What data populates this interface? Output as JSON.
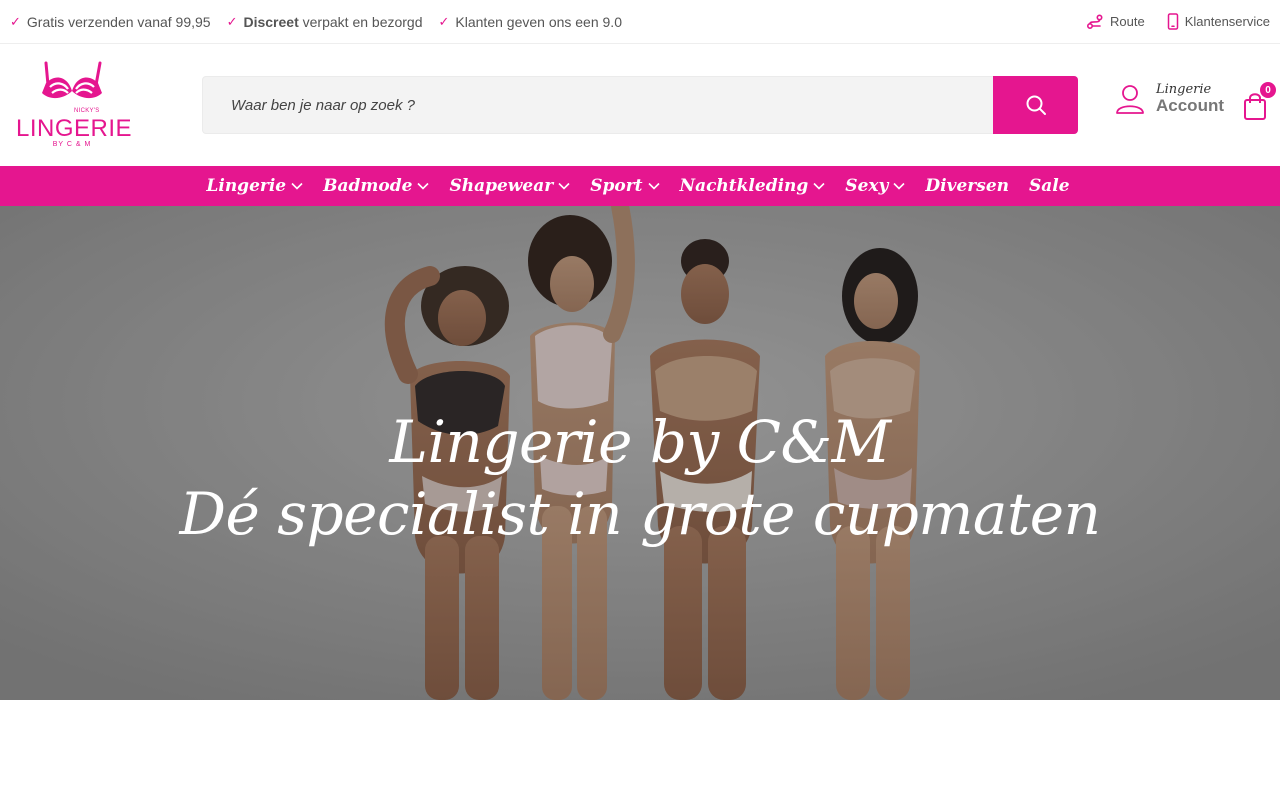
{
  "topbar": {
    "usps": [
      {
        "bold": "",
        "text": "Gratis verzenden vanaf 99,95"
      },
      {
        "bold": "Discreet",
        "text": " verpakt en bezorgd"
      },
      {
        "bold": "",
        "text": "Klanten geven ons een 9.0"
      }
    ],
    "check_glyph": "✓",
    "links": [
      {
        "label": "Route",
        "icon": "route-icon"
      },
      {
        "label": "Klantenservice",
        "icon": "phone-icon"
      }
    ]
  },
  "logo": {
    "small": "NICKY'S",
    "title": "LINGERIE",
    "byline": "BY C & M"
  },
  "search": {
    "placeholder": "Waar ben je naar op zoek ?"
  },
  "account": {
    "small": "Lingerie",
    "label": "Account"
  },
  "cart": {
    "count": "0"
  },
  "nav": {
    "items": [
      {
        "label": "Lingerie",
        "has_dropdown": true
      },
      {
        "label": "Badmode",
        "has_dropdown": true
      },
      {
        "label": "Shapewear",
        "has_dropdown": true
      },
      {
        "label": "Sport",
        "has_dropdown": true
      },
      {
        "label": "Nachtkleding",
        "has_dropdown": true
      },
      {
        "label": "Sexy",
        "has_dropdown": true
      },
      {
        "label": "Diversen",
        "has_dropdown": false
      },
      {
        "label": "Sale",
        "has_dropdown": false
      }
    ]
  },
  "hero": {
    "line1": "Lingerie by C&M",
    "line2": "Dé specialist in grote cupmaten"
  },
  "colors": {
    "brand": "#e5168f",
    "text": "#555555",
    "search_bg": "#f3f3f3"
  }
}
